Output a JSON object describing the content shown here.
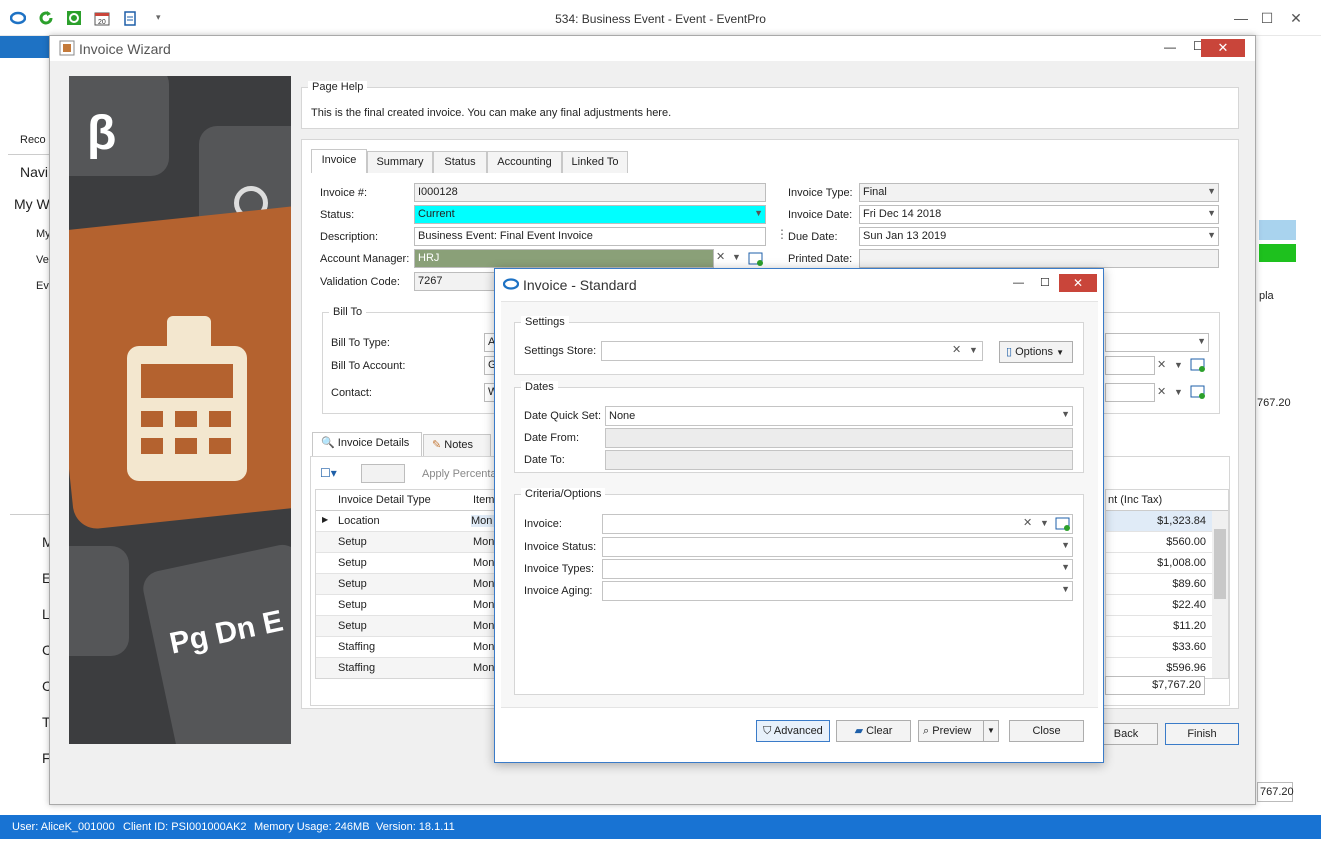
{
  "main_window": {
    "title": "534: Business Event - Event - EventPro",
    "ribbon_label": "Reco",
    "left_nav": [
      "Navi",
      "My W",
      "My",
      "Ve",
      "Ev",
      "M",
      "E",
      "L",
      "C",
      "C",
      "T",
      "F"
    ],
    "right_values": {
      "total": "767.20",
      "total2": "767.20",
      "tabs_text": "pla"
    }
  },
  "status_bar": {
    "user": "User: AliceK_001000",
    "client": "Client ID: PSI001000AK2",
    "memory": "Memory Usage: 246MB",
    "version": "Version: 18.1.11"
  },
  "wizard": {
    "title": "Invoice Wizard",
    "page_help": {
      "title": "Page Help",
      "text": "This is the final created invoice.  You can make any final adjustments here."
    },
    "tabs": [
      "Invoice",
      "Summary",
      "Status",
      "Accounting",
      "Linked To"
    ],
    "fields": {
      "invoice_no_label": "Invoice #:",
      "invoice_no": "I000128",
      "status_label": "Status:",
      "status": "Current",
      "description_label": "Description:",
      "description": "Business Event: Final Event Invoice",
      "account_manager_label": "Account Manager:",
      "account_manager": "HRJ",
      "validation_code_label": "Validation Code:",
      "validation_code": "7267",
      "invoice_type_label": "Invoice Type:",
      "invoice_type": "Final",
      "invoice_date_label": "Invoice Date:",
      "invoice_date": "Fri Dec 14 2018",
      "due_date_label": "Due Date:",
      "due_date": "Sun Jan 13 2019",
      "printed_date_label": "Printed Date:"
    },
    "bill_to": {
      "title": "Bill To",
      "type_label": "Bill To Type:",
      "type_value": "A",
      "account_label": "Bill To Account:",
      "account_value": "G",
      "contact_label": "Contact:",
      "contact_value": "W"
    },
    "detail_tabs": [
      "Invoice Details",
      "Notes"
    ],
    "apply_percentage": "Apply Percenta",
    "grid": {
      "col_type": "Invoice Detail Type",
      "col_item": "Item",
      "col_amount": "nt (Inc Tax)",
      "rows": [
        {
          "type": "Location",
          "item": "Mon",
          "amount": "$1,323.84"
        },
        {
          "type": "Setup",
          "item": "Mon",
          "amount": "$560.00"
        },
        {
          "type": "Setup",
          "item": "Mon",
          "amount": "$1,008.00"
        },
        {
          "type": "Setup",
          "item": "Mon",
          "amount": "$89.60"
        },
        {
          "type": "Setup",
          "item": "Mon",
          "amount": "$22.40"
        },
        {
          "type": "Setup",
          "item": "Mon",
          "amount": "$11.20"
        },
        {
          "type": "Staffing",
          "item": "Mon",
          "amount": "$33.60"
        },
        {
          "type": "Staffing",
          "item": "Mon",
          "amount": "$596.96"
        }
      ],
      "total": "$7,767.20"
    },
    "buttons": {
      "back": "Back",
      "finish": "Finish"
    }
  },
  "dialog": {
    "title": "Invoice - Standard",
    "settings": {
      "title": "Settings",
      "store_label": "Settings Store:",
      "store_value": "",
      "options": "Options"
    },
    "dates": {
      "title": "Dates",
      "quick_set_label": "Date Quick Set:",
      "quick_set_value": "None",
      "from_label": "Date From:",
      "to_label": "Date To:"
    },
    "criteria": {
      "title": "Criteria/Options",
      "invoice_label": "Invoice:",
      "status_label": "Invoice Status:",
      "types_label": "Invoice Types:",
      "aging_label": "Invoice Aging:"
    },
    "buttons": {
      "advanced": "Advanced",
      "clear": "Clear",
      "preview": "Preview",
      "close": "Close"
    }
  },
  "colors": {
    "status_bg": "#00ffff",
    "manager_bg": "#8aa078",
    "statusbar": "#1873d3",
    "close_red": "#c9453a"
  }
}
